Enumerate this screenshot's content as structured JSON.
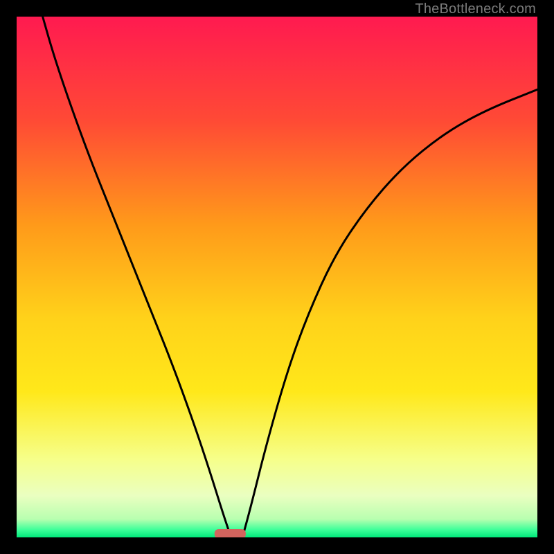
{
  "watermark": "TheBottleneck.com",
  "chart_data": {
    "type": "line",
    "title": "",
    "xlabel": "",
    "ylabel": "",
    "xlim": [
      0,
      100
    ],
    "ylim": [
      0,
      100
    ],
    "background_gradient": {
      "stops": [
        {
          "offset": 0.0,
          "color": "#ff1a50"
        },
        {
          "offset": 0.2,
          "color": "#ff4a35"
        },
        {
          "offset": 0.4,
          "color": "#ff9a1a"
        },
        {
          "offset": 0.58,
          "color": "#ffd21a"
        },
        {
          "offset": 0.72,
          "color": "#ffe81a"
        },
        {
          "offset": 0.85,
          "color": "#f6ff8a"
        },
        {
          "offset": 0.92,
          "color": "#eaffc0"
        },
        {
          "offset": 0.965,
          "color": "#b8ffb0"
        },
        {
          "offset": 0.985,
          "color": "#3fff9a"
        },
        {
          "offset": 1.0,
          "color": "#00e87a"
        }
      ]
    },
    "marker": {
      "x": 41,
      "y": 0,
      "width": 6,
      "color": "#d2645e"
    },
    "series": [
      {
        "name": "left-branch",
        "points": [
          {
            "x": 5.0,
            "y": 100.0
          },
          {
            "x": 7.0,
            "y": 93.0
          },
          {
            "x": 10.0,
            "y": 84.0
          },
          {
            "x": 14.0,
            "y": 73.0
          },
          {
            "x": 18.0,
            "y": 63.0
          },
          {
            "x": 22.0,
            "y": 53.0
          },
          {
            "x": 26.0,
            "y": 43.0
          },
          {
            "x": 30.0,
            "y": 33.0
          },
          {
            "x": 34.0,
            "y": 22.0
          },
          {
            "x": 37.0,
            "y": 13.0
          },
          {
            "x": 39.5,
            "y": 5.0
          },
          {
            "x": 41.0,
            "y": 0.5
          }
        ]
      },
      {
        "name": "right-branch",
        "points": [
          {
            "x": 43.5,
            "y": 0.5
          },
          {
            "x": 45.0,
            "y": 6.0
          },
          {
            "x": 48.0,
            "y": 18.0
          },
          {
            "x": 52.0,
            "y": 32.0
          },
          {
            "x": 56.0,
            "y": 43.0
          },
          {
            "x": 61.0,
            "y": 54.0
          },
          {
            "x": 67.0,
            "y": 63.0
          },
          {
            "x": 74.0,
            "y": 71.0
          },
          {
            "x": 82.0,
            "y": 77.5
          },
          {
            "x": 90.0,
            "y": 82.0
          },
          {
            "x": 100.0,
            "y": 86.0
          }
        ]
      }
    ]
  }
}
